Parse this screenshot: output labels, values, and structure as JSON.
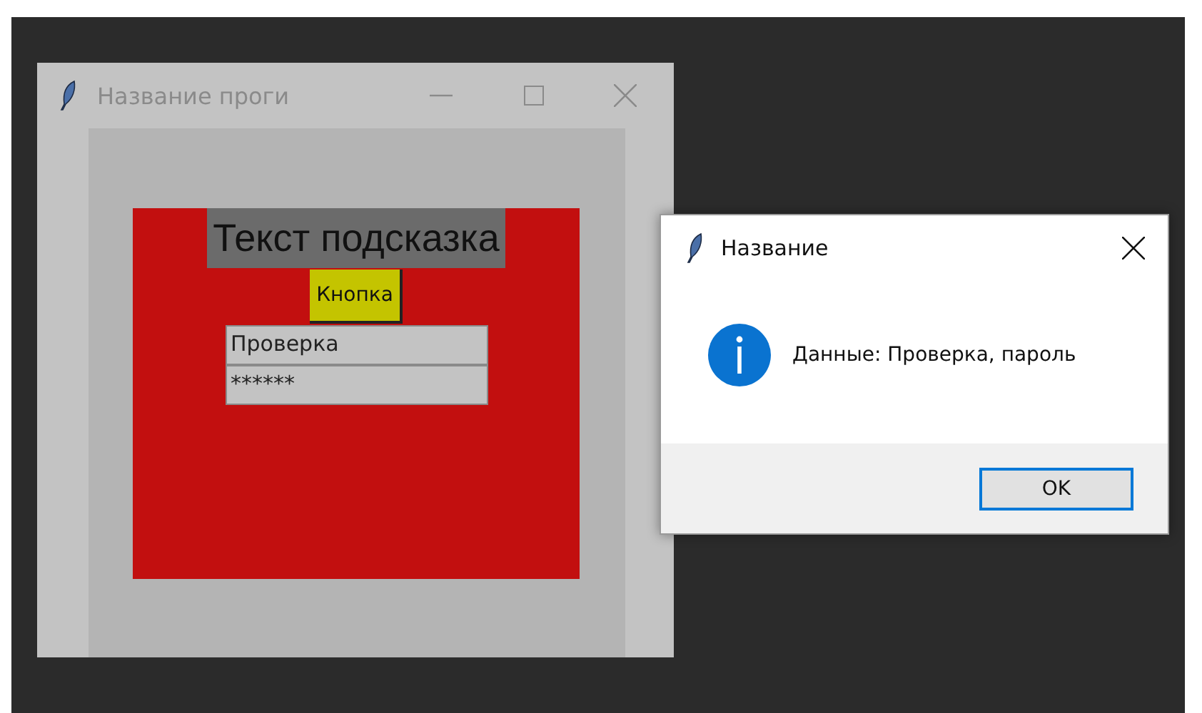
{
  "main_window": {
    "title": "Название проги",
    "active": false,
    "label": "Текст подсказка",
    "button": "Кнопка",
    "fields": [
      {
        "value": "Проверка"
      },
      {
        "value": "******"
      }
    ]
  },
  "dialog": {
    "title": "Название",
    "active": true,
    "message": "Данные: Проверка, пароль",
    "buttons": [
      "OK"
    ]
  }
}
